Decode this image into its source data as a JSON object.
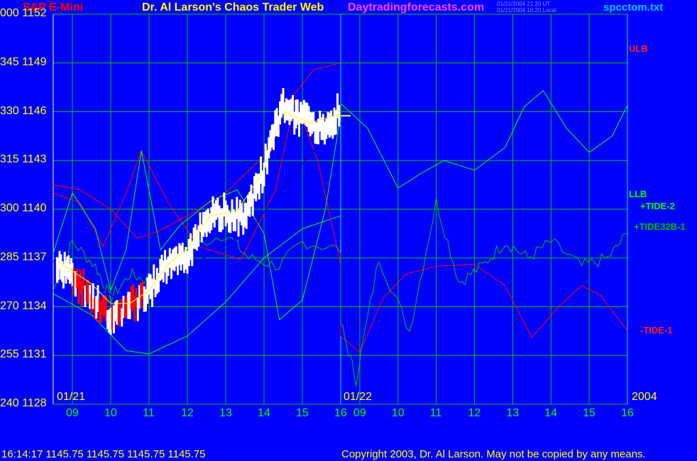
{
  "header": {
    "symbol": "S&P E-Mini",
    "site_title": "Dr. Al Larson's Chaos Trader Web",
    "site_url": "Daytradingforecasts.com",
    "ut_time": "01/21/2004 21:20 UT",
    "local_time": "01/21/2004 16:20 Local",
    "filename": "spcctom.txt"
  },
  "dates": {
    "left": "01/21",
    "middle": "01/22",
    "year": "2004"
  },
  "series_labels": {
    "ulb": "ULB",
    "llb": "LLB",
    "tide2": "+TIDE-2",
    "tide32b": "+TIDE32B-1",
    "tide1": "-TIDE-1"
  },
  "footer": {
    "quote": "16:14:17  1145.75 1145.75 1145.75 1145.75",
    "copyright": "Copyright 2003, Dr. Al Larson. May not be copied by any means."
  },
  "colors": {
    "background": "#0000ff",
    "grid": "#00c000",
    "axis_labels": "#ffff00",
    "time_labels": "#00ff00",
    "ulb": "#ff0000",
    "tide1": "#ff0000",
    "tide2": "#00ff00",
    "tide32b": "#00c000",
    "bars_up": "#ffffff",
    "bars_down": "#ff0000",
    "moving_avg_fast": "#ffff00",
    "moving_avg_slow": "#0000c0"
  },
  "chart_data": {
    "type": "line",
    "title": "S&P E-Mini",
    "y_axis": {
      "primary_labels": [
        "000",
        "345",
        "330",
        "315",
        "300",
        "285",
        "270",
        "255",
        "240"
      ],
      "price_labels": [
        "1152",
        "1149",
        "1146",
        "1143",
        "1140",
        "1137",
        "1134",
        "1131",
        "1128"
      ],
      "ylim": [
        1128,
        1152
      ]
    },
    "x_axis": {
      "day1_hours": [
        "09",
        "10",
        "11",
        "12",
        "13",
        "14",
        "15",
        "16"
      ],
      "day2_hours": [
        "09",
        "10",
        "11",
        "12",
        "13",
        "14",
        "15",
        "16"
      ]
    },
    "last_price": 1145.75,
    "series": [
      {
        "name": "S&P E-Mini (price bars)",
        "color": "#ffffff",
        "x": [
          8.6,
          9.0,
          9.5,
          10.0,
          10.5,
          11.0,
          11.5,
          12.0,
          12.5,
          13.0,
          13.5,
          14.0,
          14.5,
          15.0,
          15.5,
          16.0
        ],
        "values": [
          1136.5,
          1136.0,
          1134.5,
          1133.5,
          1134.0,
          1135.0,
          1136.8,
          1137.0,
          1139.5,
          1139.8,
          1139.5,
          1142.5,
          1146.5,
          1145.5,
          1145.0,
          1146.0
        ]
      },
      {
        "name": "ULB",
        "color": "#ff0000"
      },
      {
        "name": "LLB",
        "color": "#00ff00"
      },
      {
        "name": "+TIDE-2",
        "color": "#00ff00"
      },
      {
        "name": "+TIDE32B-1",
        "color": "#00c000"
      },
      {
        "name": "-TIDE-1",
        "color": "#ff0000"
      }
    ]
  }
}
